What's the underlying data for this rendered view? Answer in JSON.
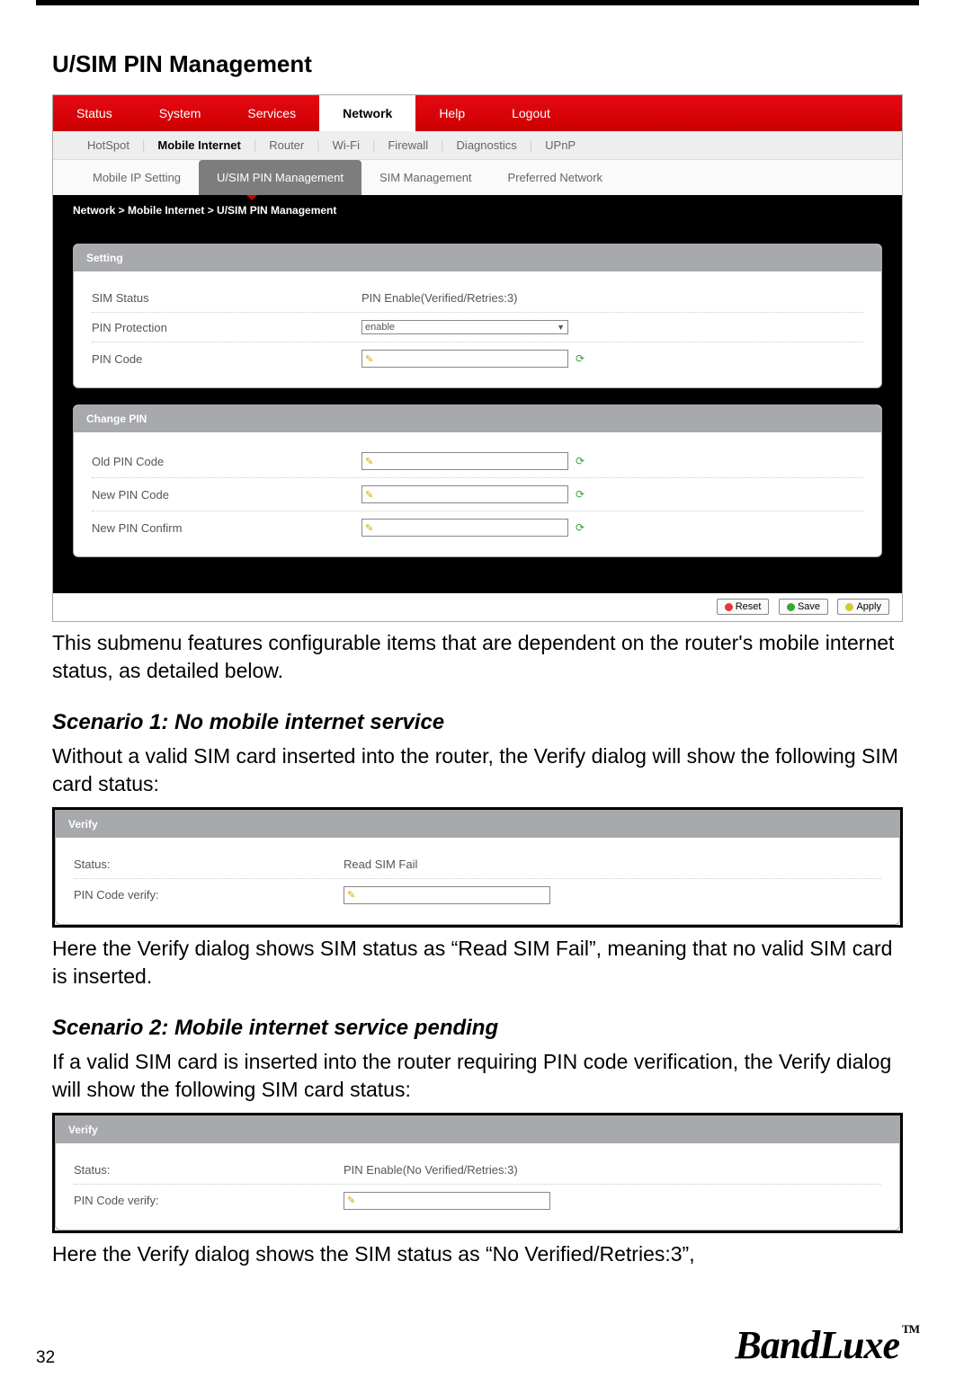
{
  "page": {
    "title": "U/SIM PIN Management",
    "number": "32",
    "brand": "BandLuxe",
    "tm": "TM"
  },
  "mainnav": {
    "items": [
      "Status",
      "System",
      "Services",
      "Network",
      "Help",
      "Logout"
    ],
    "active": "Network"
  },
  "subnav": {
    "items": [
      "HotSpot",
      "Mobile Internet",
      "Router",
      "Wi-Fi",
      "Firewall",
      "Diagnostics",
      "UPnP"
    ],
    "active": "Mobile Internet"
  },
  "subtabs": {
    "items": [
      "Mobile IP Setting",
      "U/SIM PIN Management",
      "SIM Management",
      "Preferred Network"
    ],
    "active": "U/SIM PIN Management"
  },
  "breadcrumb": "Network > Mobile Internet > U/SIM PIN Management",
  "settings": {
    "title": "Setting",
    "rows": {
      "simStatusLabel": "SIM Status",
      "simStatusValue": "PIN Enable(Verified/Retries:3)",
      "pinProtectionLabel": "PIN Protection",
      "pinProtectionValue": "enable",
      "pinCodeLabel": "PIN Code"
    }
  },
  "changePin": {
    "title": "Change PIN",
    "oldPinLabel": "Old PIN Code",
    "newPinLabel": "New PIN Code",
    "confirmLabel": "New PIN Confirm"
  },
  "buttons": {
    "reset": "Reset",
    "save": "Save",
    "apply": "Apply"
  },
  "text": {
    "intro": "This submenu features configurable items that are dependent on the router's mobile internet status, as detailed below.",
    "scenario1_title": "Scenario 1: No mobile internet service",
    "scenario1_body": "Without a valid SIM card inserted into the router, the Verify dialog will show the following SIM card status:",
    "scenario1_after": "Here the Verify dialog shows SIM status as “Read SIM Fail”, meaning that no valid SIM card is inserted.",
    "scenario2_title": "Scenario 2: Mobile internet service pending",
    "scenario2_body": "If a valid SIM card is inserted into the router requiring PIN code verification, the Verify dialog will show the following SIM card status:",
    "scenario2_after": "Here the Verify dialog shows the SIM status as “No Verified/Retries:3”,"
  },
  "verify1": {
    "title": "Verify",
    "statusLabel": "Status:",
    "statusValue": "Read SIM Fail",
    "verifyLabel": "PIN Code verify:"
  },
  "verify2": {
    "title": "Verify",
    "statusLabel": "Status:",
    "statusValue": "PIN Enable(No Verified/Retries:3)",
    "verifyLabel": "PIN Code verify:"
  }
}
